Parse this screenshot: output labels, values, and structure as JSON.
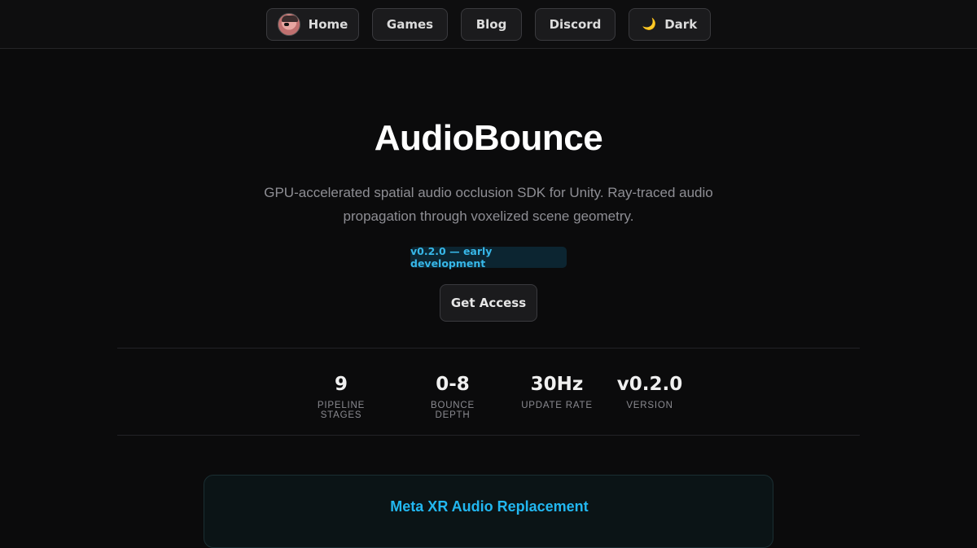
{
  "nav": {
    "home_label": "Home",
    "games_label": "Games",
    "blog_label": "Blog",
    "discord_label": "Discord",
    "theme_icon": "moon-icon",
    "theme_glyph": "🌙",
    "theme_label": "Dark"
  },
  "hero": {
    "title": "AudioBounce",
    "description": "GPU-accelerated spatial audio occlusion SDK for Unity. Ray-traced audio propagation through voxelized scene geometry.",
    "badge": "v0.2.0 — early development",
    "cta_label": "Get Access"
  },
  "stats": [
    {
      "value": "9",
      "label": "PIPELINE STAGES"
    },
    {
      "value": "0-8",
      "label": "BOUNCE DEPTH"
    },
    {
      "value": "30Hz",
      "label": "UPDATE RATE"
    },
    {
      "value": "v0.2.0",
      "label": "VERSION"
    }
  ],
  "feature_card": {
    "title": "Meta XR Audio Replacement"
  },
  "colors": {
    "background": "#0b0b0c",
    "accent": "#22b7f0",
    "badge_bg": "#0c2531",
    "button_bg": "#1b1b1d"
  }
}
